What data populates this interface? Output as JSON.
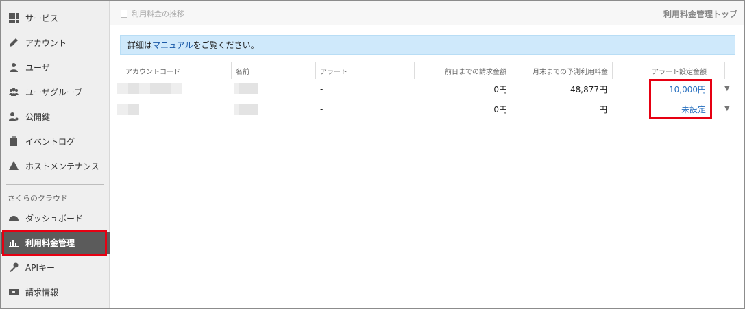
{
  "sidebar": {
    "items": [
      {
        "label": "サービス",
        "icon": "grid-icon"
      },
      {
        "label": "アカウント",
        "icon": "pen-icon"
      },
      {
        "label": "ユーザ",
        "icon": "user-icon"
      },
      {
        "label": "ユーザグループ",
        "icon": "users-icon"
      },
      {
        "label": "公開鍵",
        "icon": "user-key-icon"
      },
      {
        "label": "イベントログ",
        "icon": "clipboard-icon"
      },
      {
        "label": "ホストメンテナンス",
        "icon": "warning-icon"
      }
    ],
    "group_label": "さくらのクラウド",
    "group_items": [
      {
        "label": "ダッシュボード",
        "icon": "dashboard-icon"
      },
      {
        "label": "利用料金管理",
        "icon": "bar-chart-icon",
        "active": true
      },
      {
        "label": "APIキー",
        "icon": "key-icon"
      },
      {
        "label": "請求情報",
        "icon": "bill-icon"
      }
    ]
  },
  "topbar": {
    "breadcrumb": "利用料金の推移",
    "right_link": "利用料金管理トップ"
  },
  "notice": {
    "prefix": "詳細は",
    "link": "マニュアル",
    "suffix": "をご覧ください。"
  },
  "table": {
    "headers": [
      "アカウントコード",
      "名前",
      "アラート",
      "前日までの請求金額",
      "月末までの予測利用料金",
      "アラート設定金額"
    ],
    "rows": [
      {
        "alert": "-",
        "billed": "0円",
        "forecast": "48,877円",
        "alert_amount": "10,000円"
      },
      {
        "alert": "-",
        "billed": "0円",
        "forecast": "- 円",
        "alert_amount": "未設定"
      }
    ]
  },
  "colors": {
    "highlight": "#e60012",
    "link": "#2870bf",
    "notice_bg": "#cfe9fb"
  }
}
